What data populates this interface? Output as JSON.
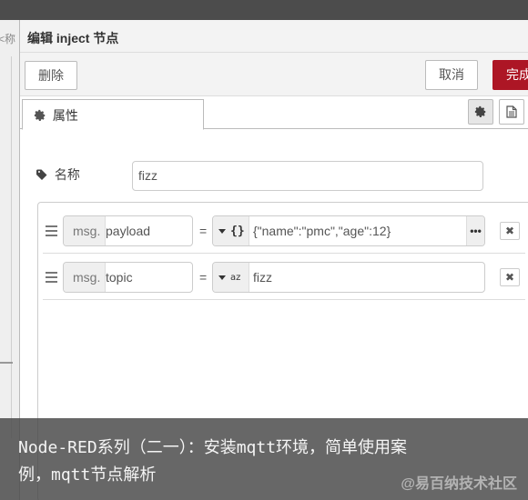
{
  "workspace": {
    "tab_fragment": "<称"
  },
  "tray": {
    "title": "编辑 inject 节点",
    "toolbar": {
      "delete_label": "删除",
      "cancel_label": "取消",
      "done_label": "完成",
      "done_color": "#ad1625"
    },
    "tabs": {
      "properties_label": "属性",
      "gear_icon": "gear-icon",
      "doc_icon": "document-icon"
    },
    "form": {
      "name_label": "名称",
      "name_value": "fizz",
      "props": [
        {
          "prefix": "msg.",
          "property": "payload",
          "equals": "=",
          "type_glyph": "{}",
          "value": "{\"name\":\"pmc\",\"age\":12}",
          "expand": "•••",
          "remove": "✖"
        },
        {
          "prefix": "msg.",
          "property": "topic",
          "equals": "=",
          "type_glyph": "az",
          "value": "fizz",
          "remove": "✖"
        }
      ]
    }
  },
  "caption": {
    "line": "Node-RED系列（二一）：安装mqtt环境，简单使用案例，mqtt节点解析",
    "credit": "@易百纳技术社区"
  }
}
